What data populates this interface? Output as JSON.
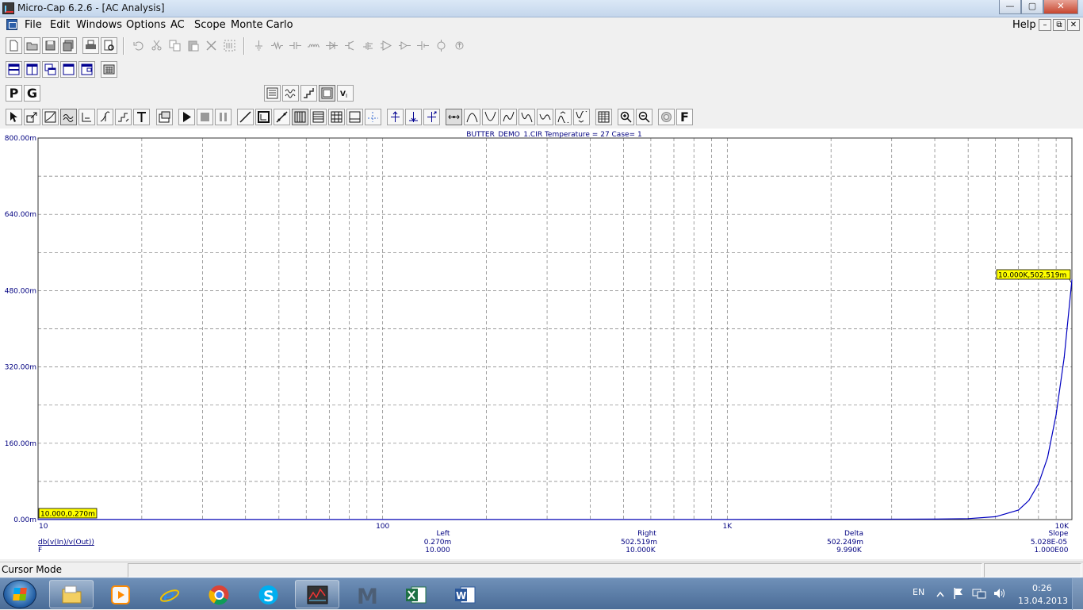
{
  "window": {
    "title": "Micro-Cap 6.2.6 - [AC Analysis]",
    "buttons": {
      "minimize": "—",
      "maximize": "▢",
      "close": "✕"
    }
  },
  "menu": {
    "items": [
      "File",
      "Edit",
      "Windows",
      "Options",
      "AC",
      "Scope",
      "Monte Carlo"
    ],
    "help": "Help",
    "mdi": {
      "minimize": "–",
      "restore": "⧉",
      "close": "✕"
    }
  },
  "toolbar": {
    "letters": {
      "p": "P",
      "g": "G",
      "t": "T",
      "f": "F"
    }
  },
  "plot": {
    "header": "BUTTER_DEMO_1.CIR Temperature = 27 Case= 1",
    "y_ticks": [
      "800.00m",
      "640.00m",
      "480.00m",
      "320.00m",
      "160.00m",
      "0.00m"
    ],
    "x_ticks": [
      "10",
      "100",
      "1K",
      "10K"
    ],
    "expression_y": "db(v(In)/v(Out))",
    "expression_x": "F",
    "cursor_left_tag": "10.000,0.270m",
    "cursor_right_tag": "10.000K,502.519m",
    "curve_color": "#0000c0"
  },
  "chart_data": {
    "type": "line",
    "title": "BUTTER_DEMO_1.CIR Temperature = 27 Case= 1",
    "xlabel": "F",
    "ylabel": "db(v(In)/v(Out))",
    "x_scale": "log",
    "xlim": [
      10,
      10000
    ],
    "ylim": [
      0,
      0.8
    ],
    "grid": true,
    "series": [
      {
        "name": "db(v(In)/v(Out))",
        "x": [
          10,
          100,
          1000,
          4000,
          5000,
          6000,
          7000,
          7500,
          8000,
          8500,
          9000,
          9500,
          10000
        ],
        "y": [
          0.00027,
          0.00027,
          0.0003,
          0.001,
          0.002,
          0.006,
          0.02,
          0.04,
          0.075,
          0.13,
          0.22,
          0.34,
          0.502519
        ]
      }
    ]
  },
  "readout": {
    "columns": [
      {
        "header": "Left",
        "y": "0.270m",
        "x": "10.000"
      },
      {
        "header": "Right",
        "y": "502.519m",
        "x": "10.000K"
      },
      {
        "header": "Delta",
        "y": "502.249m",
        "x": "9.990K"
      },
      {
        "header": "Slope",
        "y": "5.028E-05",
        "x": "1.000E00"
      }
    ]
  },
  "status": {
    "mode": "Cursor Mode"
  },
  "taskbar": {
    "apps": [
      "explorer",
      "media-player",
      "internet-explorer",
      "chrome",
      "skype",
      "micro-cap",
      "matlab",
      "excel",
      "word"
    ],
    "language": "EN",
    "time": "0:26",
    "date": "13.04.2013"
  }
}
